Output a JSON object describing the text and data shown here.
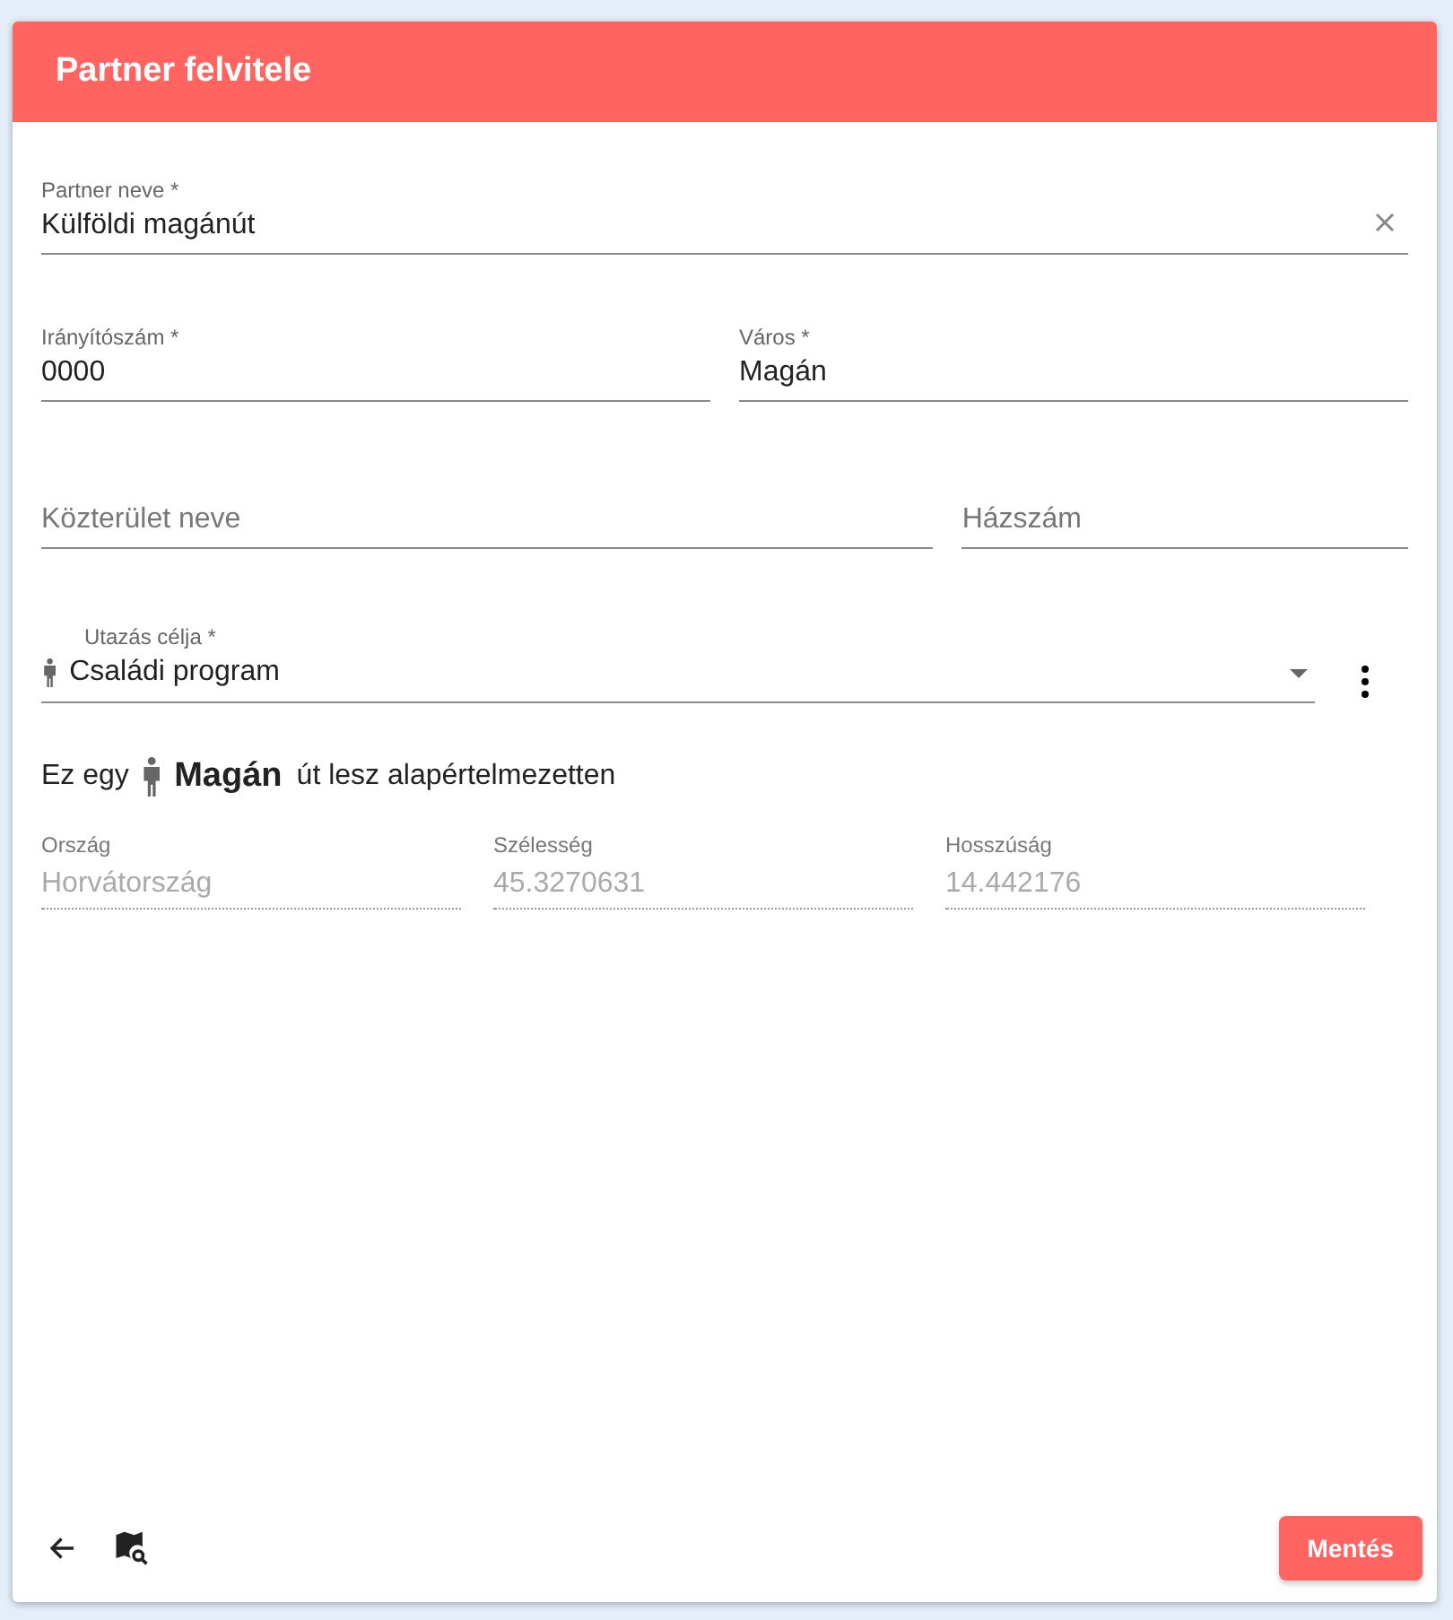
{
  "header": {
    "title": "Partner felvitele"
  },
  "field_rows": [
    [
      {
        "label": "Partner neve *",
        "value": "Külföldi magánút",
        "clearable": true
      }
    ],
    [
      {
        "label": "Irányítószám *",
        "value": "0000",
        "clearable": false
      },
      {
        "label": "Város *",
        "value": "Magán",
        "clearable": false
      }
    ],
    [
      {
        "placeholder": "Közterület neve",
        "clearable": false
      },
      {
        "placeholder": "Házszám",
        "clearable": false
      }
    ]
  ],
  "purpose_select": {
    "label": "Utazás célja *",
    "value": "Családi program"
  },
  "info": {
    "prefix": "Ez egy",
    "highlight": "Magán",
    "suffix": "út lesz alapértelmezetten"
  },
  "readonly_fields": [
    {
      "label": "Ország",
      "value": "Horvátország"
    },
    {
      "label": "Szélesség",
      "value": "45.3270631"
    },
    {
      "label": "Hosszúság",
      "value": "14.442176"
    }
  ],
  "footer": {
    "save_button": "Mentés"
  }
}
